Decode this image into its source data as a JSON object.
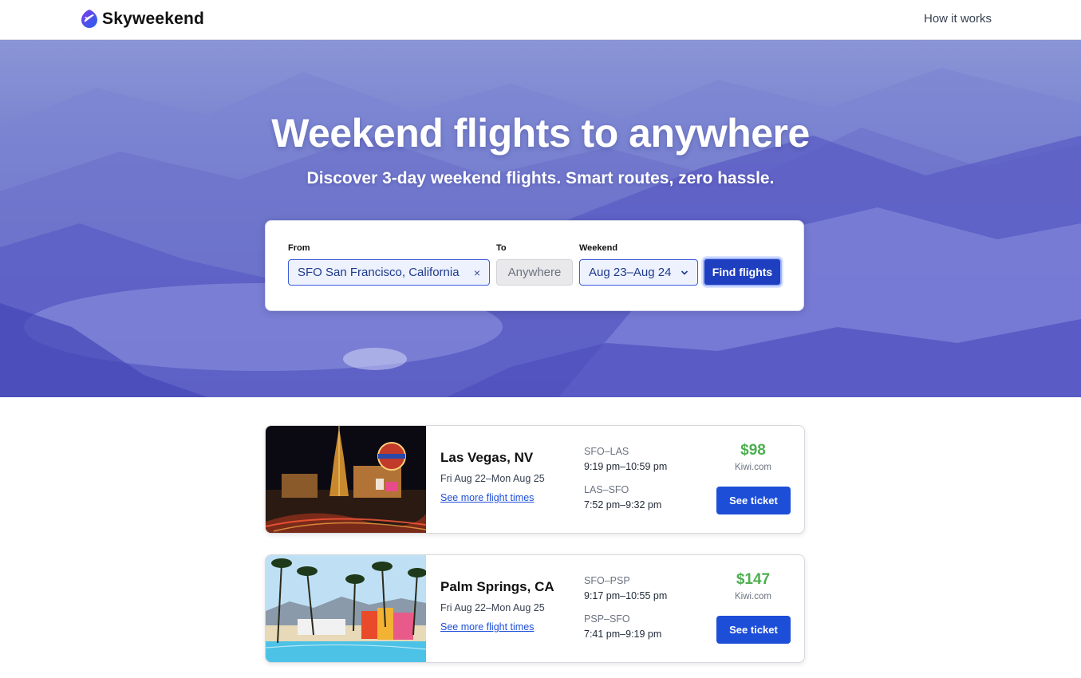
{
  "nav": {
    "brand": "Skyweekend",
    "how_it_works": "How it works"
  },
  "hero": {
    "title": "Weekend flights to anywhere",
    "subtitle": "Discover 3-day weekend flights. Smart routes, zero hassle."
  },
  "search": {
    "from_label": "From",
    "from_value": "SFO San Francisco, California",
    "from_clear": "×",
    "to_label": "To",
    "to_placeholder": "Anywhere",
    "weekend_label": "Weekend",
    "weekend_value": "Aug 23–Aug 24",
    "submit_label": "Find flights"
  },
  "results": [
    {
      "destination": "Las Vegas, NV",
      "dates": "Fri Aug 22–Mon Aug 25",
      "more_link": "See more flight times",
      "outbound_route": "SFO–LAS",
      "outbound_time": "9:19 pm–10:59 pm",
      "return_route": "LAS–SFO",
      "return_time": "7:52 pm–9:32 pm",
      "price": "$98",
      "vendor": "Kiwi.com",
      "cta": "See ticket"
    },
    {
      "destination": "Palm Springs, CA",
      "dates": "Fri Aug 22–Mon Aug 25",
      "more_link": "See more flight times",
      "outbound_route": "SFO–PSP",
      "outbound_time": "9:17 pm–10:55 pm",
      "return_route": "PSP–SFO",
      "return_time": "7:41 pm–9:19 pm",
      "price": "$147",
      "vendor": "Kiwi.com",
      "cta": "See ticket"
    }
  ],
  "colors": {
    "accent": "#1d4ed8",
    "price": "#4caf50",
    "hero_top": "#8a95d6",
    "hero_bottom": "#4f50c0"
  },
  "icons": {
    "logo": "plane-logo-icon",
    "clear": "close-icon",
    "weekend_dropdown": "chevron-down-icon"
  }
}
